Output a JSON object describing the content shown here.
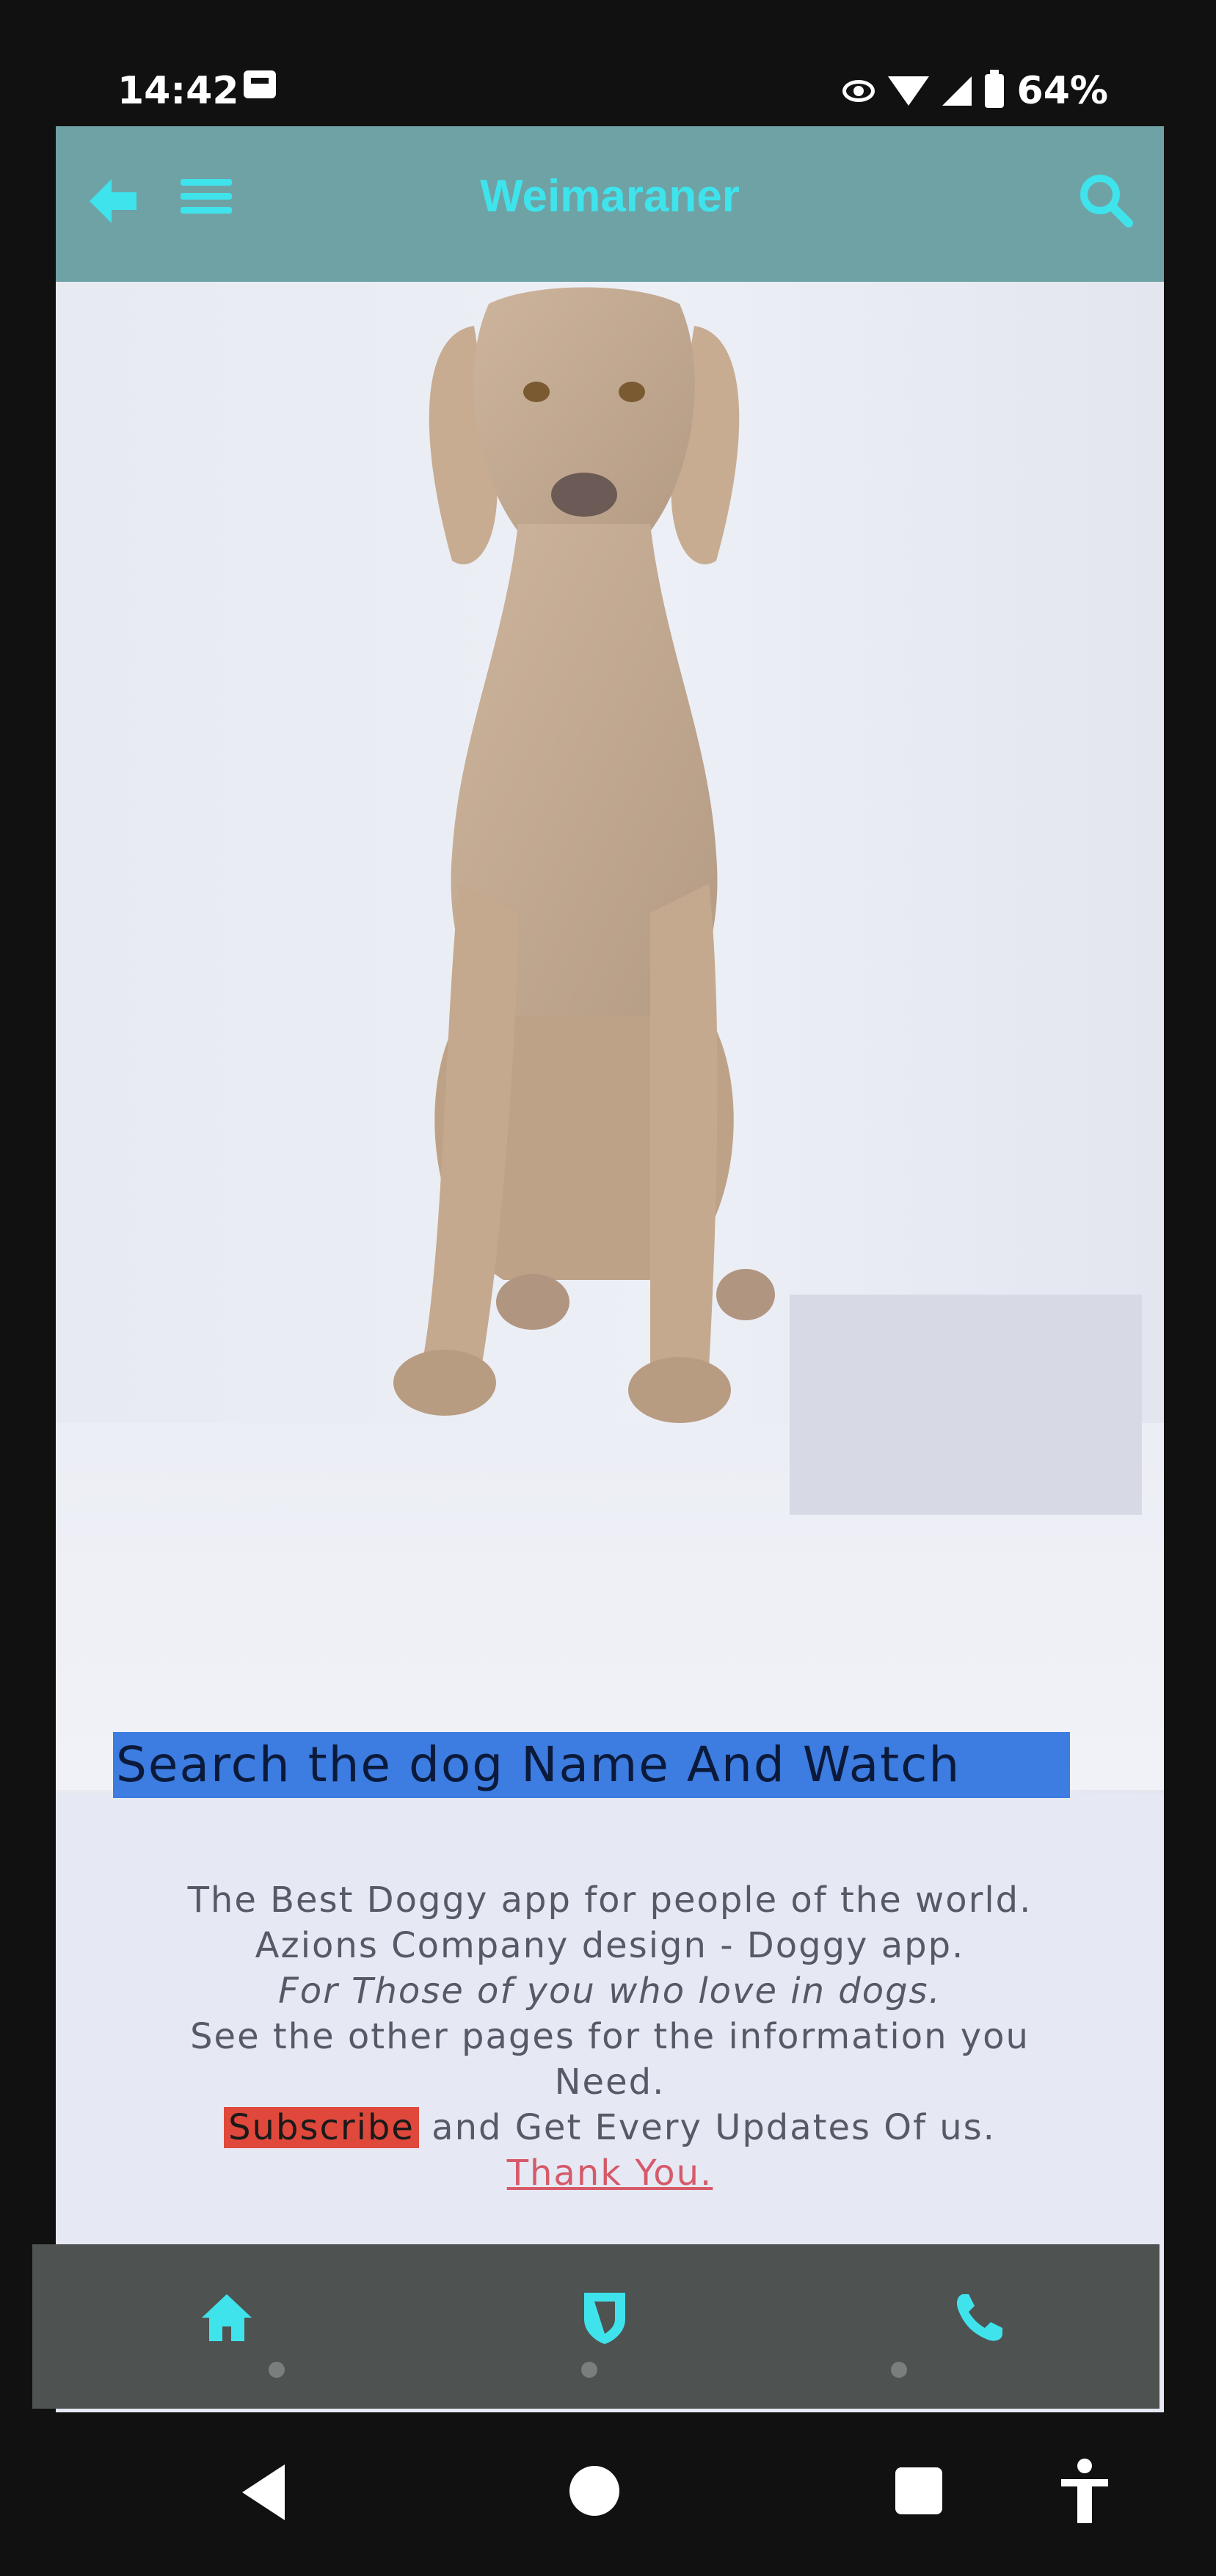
{
  "status_bar": {
    "time": "14:42",
    "battery": "64%"
  },
  "app_bar": {
    "title": "Weimaraner",
    "accent_color": "#3fe3ec",
    "background_color": "#6fa2a5"
  },
  "hero_image": {
    "subject": "weimaraner-dog-photo"
  },
  "content": {
    "selected_heading": "Search the dog Name And Watch",
    "lines": [
      "The Best Doggy app for people of the world.",
      "Azions Company design - Doggy app.",
      "For Those of you who love in dogs.",
      "See the other pages for the information you",
      "Need."
    ],
    "subscribe_label": "Subscribe",
    "subscribe_rest": " and Get Every Updates Of us.",
    "thanks_label": "Thank You."
  },
  "bottom_nav": {
    "items": [
      {
        "icon": "home-icon"
      },
      {
        "icon": "shield-icon"
      },
      {
        "icon": "phone-icon"
      }
    ]
  },
  "system_nav": {
    "buttons": [
      "back",
      "home",
      "recents",
      "accessibility"
    ]
  }
}
